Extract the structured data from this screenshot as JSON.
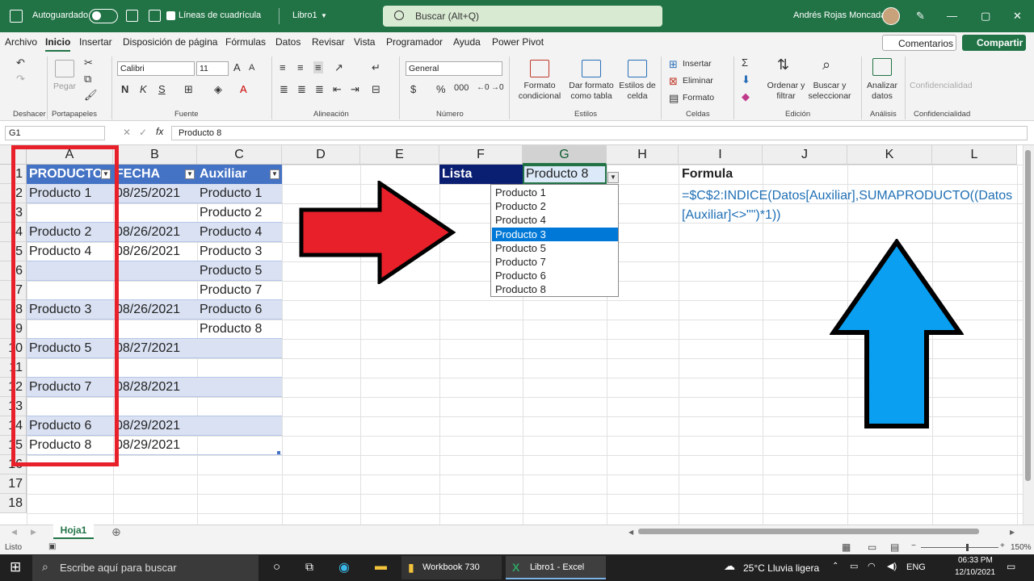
{
  "titlebar": {
    "autosave_label": "Autoguardado",
    "gridlines_label": "Líneas de cuadrícula",
    "doc_name": "Libro1",
    "search_placeholder": "Buscar (Alt+Q)",
    "user_name": "Andrés Rojas Moncada"
  },
  "menu": [
    "Archivo",
    "Inicio",
    "Insertar",
    "Disposición de página",
    "Fórmulas",
    "Datos",
    "Revisar",
    "Vista",
    "Programador",
    "Ayuda",
    "Power Pivot"
  ],
  "actions": {
    "comments": "Comentarios",
    "share": "Compartir"
  },
  "ribbon": {
    "groups": [
      "Deshacer",
      "Portapapeles",
      "Fuente",
      "Alineación",
      "Número",
      "Estilos",
      "Celdas",
      "Edición",
      "Análisis",
      "Confidencialidad"
    ],
    "paste": "Pegar",
    "font_name": "Calibri",
    "font_size": "11",
    "number_format": "General",
    "cond_format": [
      "Formato",
      "condicional"
    ],
    "table_format": [
      "Dar formato",
      "como tabla"
    ],
    "cell_styles": [
      "Estilos de",
      "celda"
    ],
    "insert": "Insertar",
    "delete": "Eliminar",
    "format": "Formato",
    "sort": [
      "Ordenar y",
      "filtrar"
    ],
    "find": [
      "Buscar y",
      "seleccionar"
    ],
    "analyze": [
      "Analizar",
      "datos"
    ],
    "confidential": "Confidencialidad"
  },
  "formula_bar": {
    "name_box": "G1",
    "formula": "Producto 8"
  },
  "columns": [
    "A",
    "B",
    "C",
    "D",
    "E",
    "F",
    "G",
    "H",
    "I",
    "J",
    "K",
    "L"
  ],
  "rows": [
    "1",
    "2",
    "3",
    "4",
    "5",
    "6",
    "7",
    "8",
    "9",
    "10",
    "11",
    "12",
    "13",
    "14",
    "15",
    "16",
    "17",
    "18"
  ],
  "table": {
    "headers": [
      "PRODUCTO",
      "FECHA",
      "Auxiliar"
    ],
    "rows": [
      [
        "Producto 1",
        "08/25/2021",
        "Producto 1"
      ],
      [
        "",
        "",
        "Producto 2"
      ],
      [
        "Producto 2",
        "08/26/2021",
        "Producto 4"
      ],
      [
        "Producto 4",
        "08/26/2021",
        "Producto 3"
      ],
      [
        "",
        "",
        "Producto 5"
      ],
      [
        "",
        "",
        "Producto 7"
      ],
      [
        "Producto 3",
        "08/26/2021",
        "Producto 6"
      ],
      [
        "",
        "",
        "Producto 8"
      ],
      [
        "Producto 5",
        "08/27/2021",
        ""
      ],
      [
        "",
        "",
        ""
      ],
      [
        "Producto 7",
        "08/28/2021",
        ""
      ],
      [
        "",
        "",
        ""
      ],
      [
        "Producto 6",
        "08/29/2021",
        ""
      ],
      [
        "Producto 8",
        "08/29/2021",
        ""
      ]
    ]
  },
  "list": {
    "header": "Lista",
    "selected": "Producto 8",
    "options": [
      "Producto 1",
      "Producto 2",
      "Producto 4",
      "Producto 3",
      "Producto 5",
      "Producto 7",
      "Producto 6",
      "Producto 8"
    ],
    "highlighted_index": 3
  },
  "formula_note": {
    "title": "Formula",
    "text": "=$C$2:INDICE(Datos[Auxiliar],SUMAPRODUCTO((Datos[Auxiliar]<>\"\")*1))"
  },
  "sheet_tab": "Hoja1",
  "status": {
    "ready": "Listo",
    "zoom": "150%"
  },
  "taskbar": {
    "search": "Escribe aquí para buscar",
    "app1": "Workbook 730",
    "app2": "Libro1 - Excel",
    "weather": "25°C  Lluvia ligera",
    "lang": "ENG",
    "time": "06:33 PM",
    "date": "12/10/2021"
  },
  "colors": {
    "excel_green": "#217346",
    "table_header": "#4472c4",
    "table_band": "#d9e1f2",
    "list_header": "#0b1f72",
    "red_arrow": "#e8202a",
    "blue_arrow": "#0a9ff0"
  }
}
